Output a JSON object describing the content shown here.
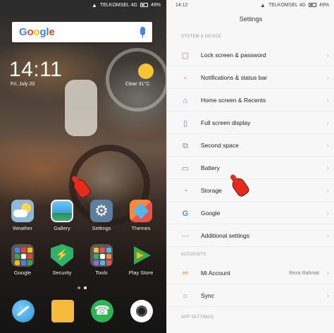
{
  "home": {
    "status": {
      "carrier": "TELKOMSEL 4G",
      "battery": "49%"
    },
    "search": {
      "logo": "Google"
    },
    "clock": {
      "time": "14:11",
      "date": "Fri, July 20"
    },
    "weather_widget": {
      "text": "Clear 31°C"
    },
    "apps_row1": [
      {
        "label": "Weather",
        "icon": "weather-icon"
      },
      {
        "label": "Gallery",
        "icon": "gallery-icon"
      },
      {
        "label": "Settings",
        "icon": "settings-gear-icon"
      },
      {
        "label": "Themes",
        "icon": "themes-icon"
      }
    ],
    "apps_row2": [
      {
        "label": "Google",
        "icon": "google-folder-icon"
      },
      {
        "label": "Security",
        "icon": "security-shield-icon"
      },
      {
        "label": "Tools",
        "icon": "tools-folder-icon"
      },
      {
        "label": "Play Store",
        "icon": "play-store-icon"
      }
    ],
    "dock": [
      "browser-icon",
      "messages-icon",
      "phone-icon",
      "camera-icon"
    ]
  },
  "settings": {
    "status": {
      "time": "14:12",
      "carrier": "TELKOMSEL 4G",
      "battery": "49%"
    },
    "title": "Settings",
    "section_device": "SYSTEM & DEVICE",
    "items_device": [
      {
        "label": "Lock screen & password",
        "icon": "lock-icon"
      },
      {
        "label": "Notifications & status bar",
        "icon": "notification-icon"
      },
      {
        "label": "Home screen & Recents",
        "icon": "home-icon"
      },
      {
        "label": "Full screen display",
        "icon": "phone-screen-icon"
      },
      {
        "label": "Second space",
        "icon": "second-space-icon"
      },
      {
        "label": "Battery",
        "icon": "battery-icon"
      },
      {
        "label": "Storage",
        "icon": "storage-icon"
      },
      {
        "label": "Google",
        "icon": "google-g-icon"
      },
      {
        "label": "Additional settings",
        "icon": "more-dots-icon"
      }
    ],
    "section_accounts": "ACCOUNTS",
    "items_accounts": [
      {
        "label": "Mi Account",
        "value": "Reza Rahmat",
        "icon": "mi-icon"
      },
      {
        "label": "Sync",
        "icon": "sync-icon"
      }
    ],
    "section_app": "APP SETTINGS"
  },
  "colors": {
    "accent": "#e0675c",
    "pointer": "#e42b1e"
  }
}
